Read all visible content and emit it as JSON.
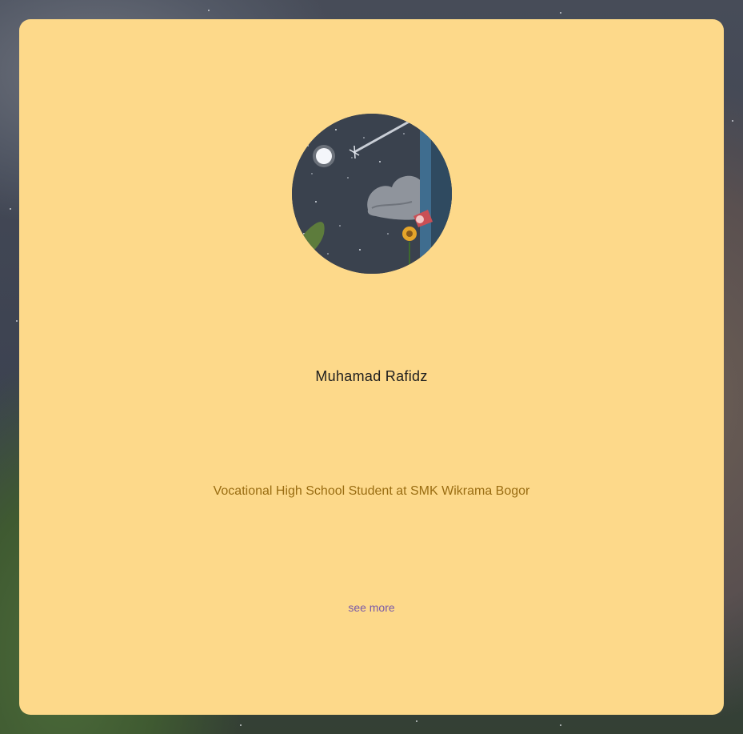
{
  "profile": {
    "name": "Muhamad Rafidz",
    "subtitle": "Vocational High School Student at SMK Wikrama Bogor",
    "see_more_label": "see more",
    "avatar_icon": "night-sky-illustration"
  },
  "colors": {
    "card_background": "#fdd98a",
    "subtitle_text": "#9a6d12",
    "link_text": "#7a5aa8",
    "name_text": "#1f1f1f"
  }
}
